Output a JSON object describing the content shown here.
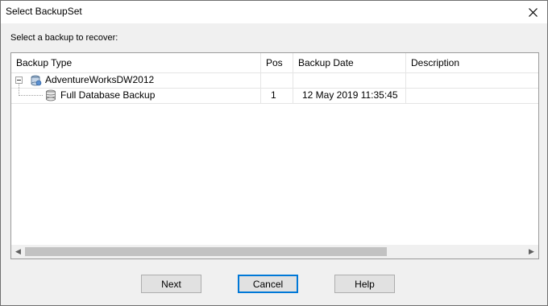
{
  "window": {
    "title": "Select BackupSet"
  },
  "prompt": "Select a backup to recover:",
  "columns": [
    "Backup Type",
    "Pos",
    "Backup Date",
    "Description"
  ],
  "rows": [
    {
      "type": "AdventureWorksDW2012",
      "pos": "",
      "date": "",
      "description": "",
      "icon": "database-server-icon"
    },
    {
      "type": "Full Database Backup",
      "pos": "1",
      "date": "12 May 2019 11:35:45",
      "description": "",
      "icon": "database-icon"
    }
  ],
  "buttons": {
    "next": "Next",
    "cancel": "Cancel",
    "help": "Help"
  }
}
